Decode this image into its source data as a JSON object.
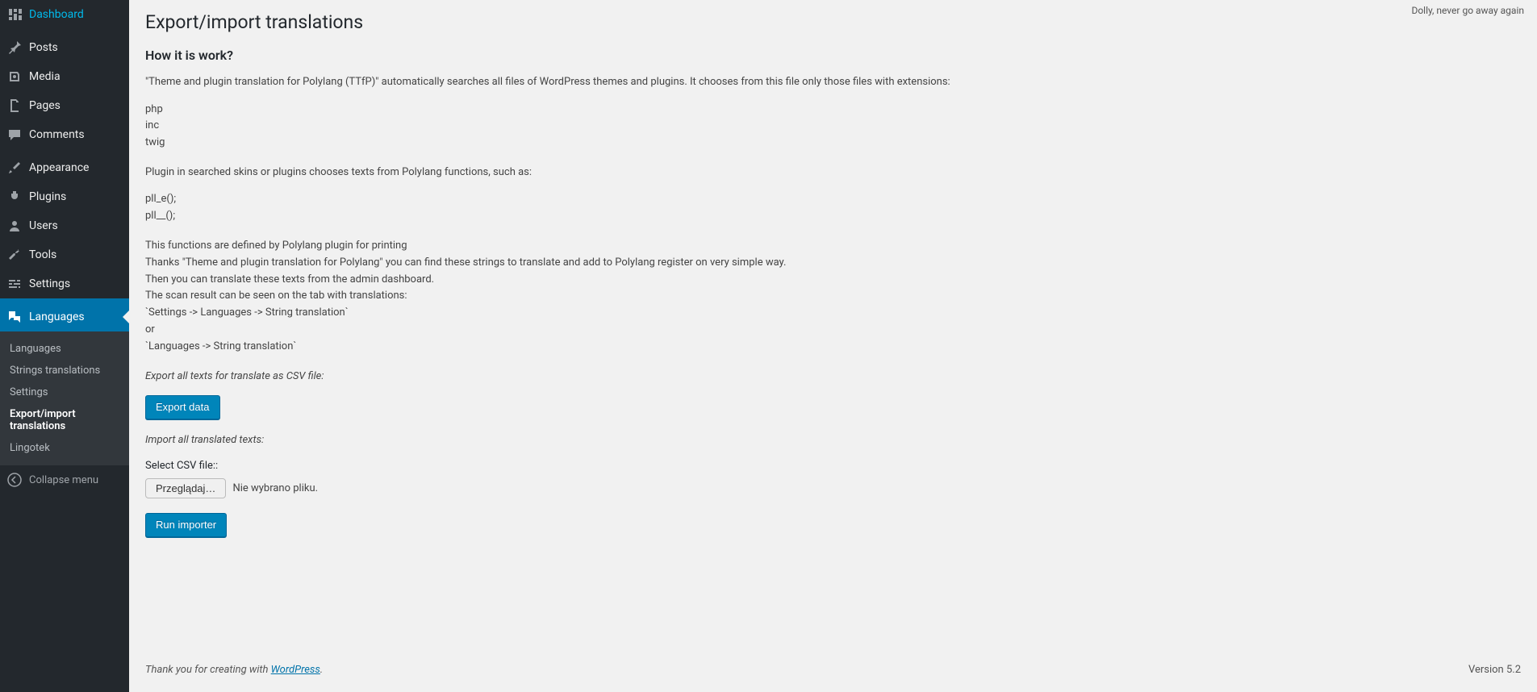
{
  "dolly": "Dolly, never go away again",
  "sidebar": {
    "items": [
      {
        "label": "Dashboard"
      },
      {
        "label": "Posts"
      },
      {
        "label": "Media"
      },
      {
        "label": "Pages"
      },
      {
        "label": "Comments"
      },
      {
        "label": "Appearance"
      },
      {
        "label": "Plugins"
      },
      {
        "label": "Users"
      },
      {
        "label": "Tools"
      },
      {
        "label": "Settings"
      },
      {
        "label": "Languages"
      }
    ],
    "submenu": [
      {
        "label": "Languages"
      },
      {
        "label": "Strings translations"
      },
      {
        "label": "Settings"
      },
      {
        "label": "Export/import translations"
      },
      {
        "label": "Lingotek"
      }
    ],
    "collapse": "Collapse menu"
  },
  "page": {
    "title": "Export/import translations",
    "how_title": "How it is work?",
    "intro": "\"Theme and plugin translation for Polylang (TTfP)\" automatically searches all files of WordPress themes and plugins. It chooses from this file only those files with extensions:",
    "ext": [
      "php",
      "inc",
      "twig"
    ],
    "plugin_line": "Plugin in searched skins or plugins chooses texts from Polylang functions, such as:",
    "funcs": [
      "pll_e();",
      "pll__();"
    ],
    "desc_lines": [
      "This functions are defined by Polylang plugin for printing",
      "Thanks \"Theme and plugin translation for Polylang\" you can find these strings to translate and add to Polylang register on very simple way.",
      "Then you can translate these texts from the admin dashboard.",
      "The scan result can be seen on the tab with translations:",
      "`Settings -> Languages -> String translation`",
      "or",
      "`Languages -> String translation`"
    ],
    "export_label": "Export all texts for translate as CSV file:",
    "export_button": "Export data",
    "import_label": "Import all translated texts:",
    "select_label": "Select CSV file::",
    "file_button": "Przeglądaj…",
    "file_status": "Nie wybrano pliku.",
    "import_button": "Run importer"
  },
  "footer": {
    "thanks_prefix": "Thank you for creating with ",
    "wp_link": "WordPress",
    "thanks_suffix": ".",
    "version": "Version 5.2"
  }
}
